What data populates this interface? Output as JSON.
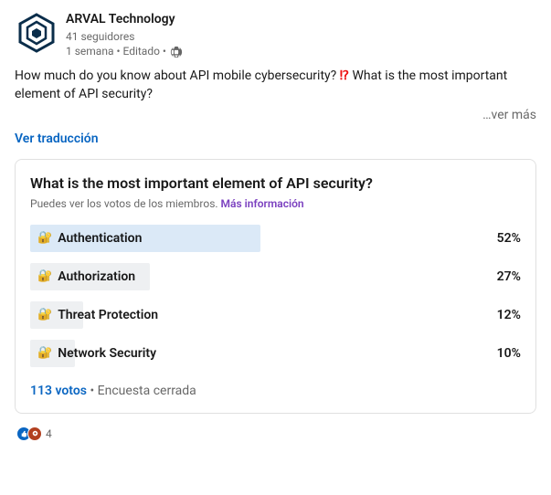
{
  "header": {
    "company": "ARVAL Technology",
    "followers": "41 seguidores",
    "timeline": "1 semana • Editado •"
  },
  "body": {
    "line1_before": "How much do you know about API mobile cybersecurity? ",
    "line1_emoji": "⁉",
    "line1_after": " What is the most important element of API security?",
    "see_more": "…ver más",
    "translate": "Ver traducción"
  },
  "poll": {
    "title": "What is the most important element of API security?",
    "subtitle_prefix": "Puedes ver los votos de los miembros. ",
    "more_info": "Más información",
    "options": [
      {
        "label": "Authentication",
        "pct": "52%",
        "top": true
      },
      {
        "label": "Authorization",
        "pct": "27%",
        "top": false
      },
      {
        "label": "Threat Protection",
        "pct": "12%",
        "top": false
      },
      {
        "label": "Network Security",
        "pct": "10%",
        "top": false
      }
    ],
    "votes": "113 votos",
    "status": "Encuesta cerrada"
  },
  "reactions": {
    "count": "4"
  },
  "chart_data": {
    "type": "bar",
    "title": "What is the most important element of API security?",
    "categories": [
      "Authentication",
      "Authorization",
      "Threat Protection",
      "Network Security"
    ],
    "values": [
      52,
      27,
      12,
      10
    ],
    "ylabel": "percent",
    "ylim": [
      0,
      100
    ],
    "total_votes": 113
  }
}
